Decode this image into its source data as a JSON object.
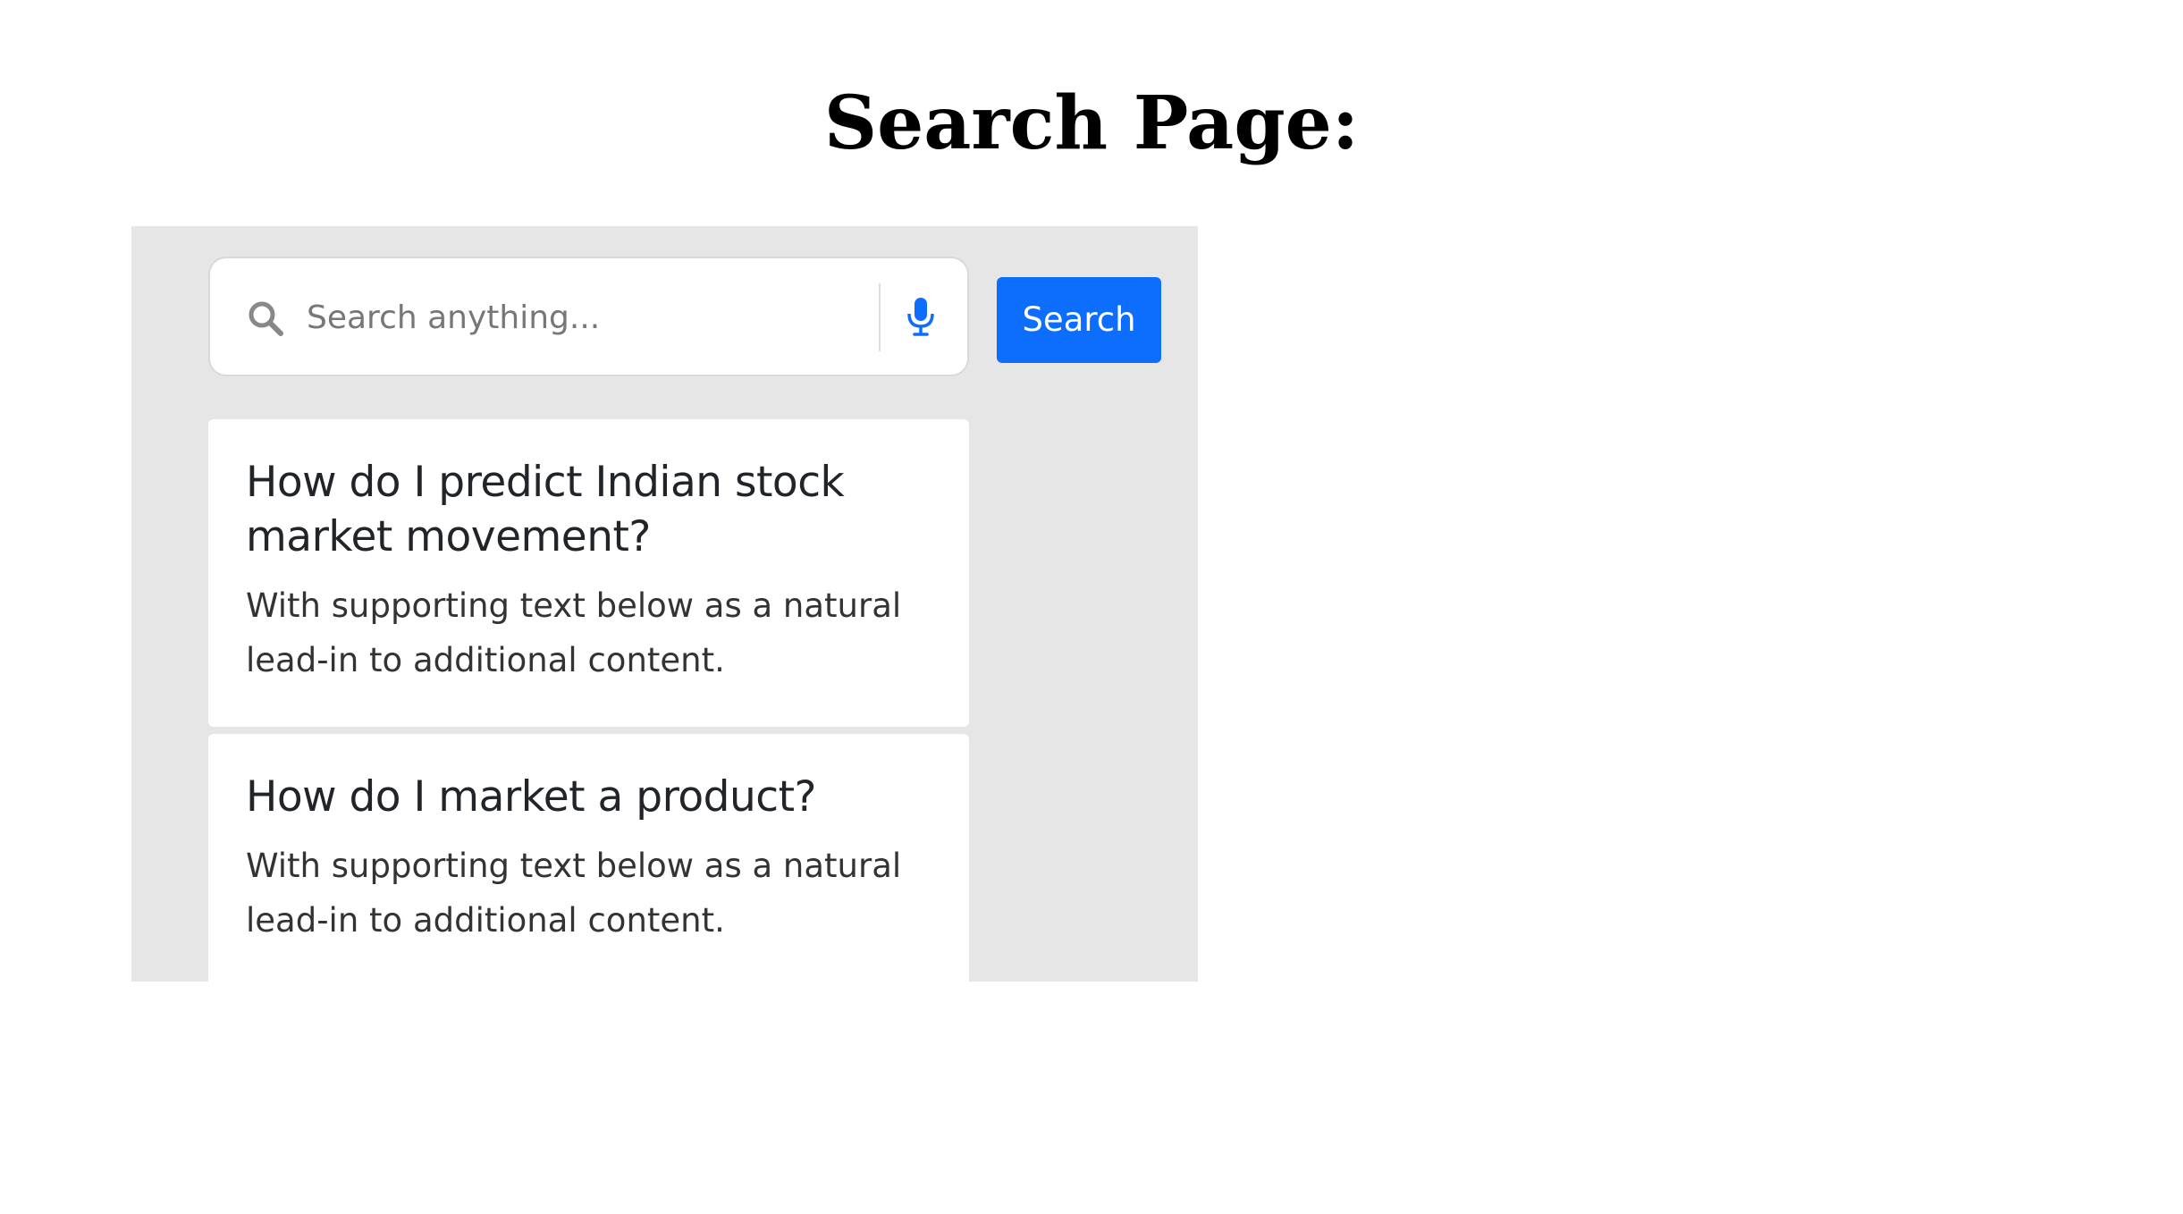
{
  "page": {
    "title": "Search Page:"
  },
  "search": {
    "placeholder": "Search anything...",
    "value": "",
    "button_label": "Search",
    "search_icon": "search-icon",
    "mic_icon": "microphone-icon"
  },
  "results": [
    {
      "title": "How do I predict Indian stock market movement?",
      "text": "With supporting text below as a natural lead-in to additional content."
    },
    {
      "title": "How do I market a product?",
      "text": "With supporting text below as a natural lead-in to additional content."
    }
  ],
  "colors": {
    "accent": "#0d6efd",
    "panel_background": "#e6e6e6",
    "card_background": "#ffffff",
    "icon_gray": "#888888"
  }
}
